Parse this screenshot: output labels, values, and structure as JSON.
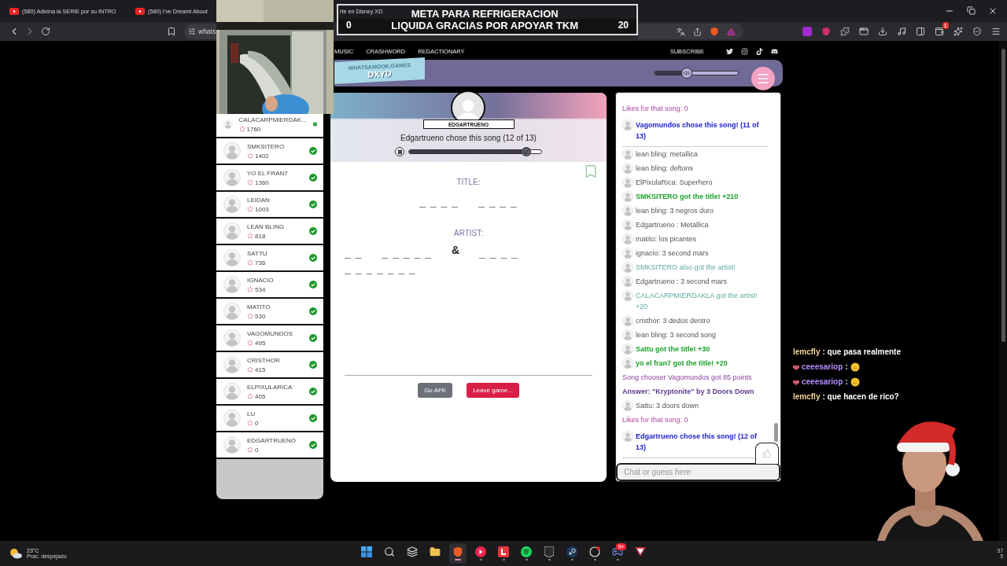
{
  "browser": {
    "tabs": [
      {
        "title": "(580) Adivina la SERIE por su INTRO",
        "selected": false
      },
      {
        "title": "(580) I've Dreamt About",
        "selected": false
      },
      {
        "title": "rte en Disney XD",
        "selected": false
      }
    ],
    "address": "whats",
    "extension_badge": "1"
  },
  "goal": {
    "current": "0",
    "lines": [
      "META PARA REFRIGERACION",
      "LIQUIDA GRACIAS POR APOYAR TKM"
    ],
    "target": "20"
  },
  "site_nav": {
    "links": [
      "MUSIC",
      "CRASHWORD",
      "REDACTIONARY"
    ],
    "subscribe": "SUBSCRIBE"
  },
  "header": {
    "logo_top": "WHATSAMOOK.GAMES",
    "logo_bottom": "DXYD",
    "volume": {
      "level": 0.39
    }
  },
  "players": [
    {
      "name": "CALACARPMIERDAK...",
      "score": "1760",
      "guessed": true
    },
    {
      "name": "SMKSITERO",
      "score": "1402",
      "guessed": true
    },
    {
      "name": "YO EL FRAN7",
      "score": "1360",
      "guessed": true
    },
    {
      "name": "LEIDAN",
      "score": "1003",
      "guessed": true
    },
    {
      "name": "LEAN BLING",
      "score": "818",
      "guessed": true
    },
    {
      "name": "SATTU",
      "score": "736",
      "guessed": true
    },
    {
      "name": "IGNACIO",
      "score": "534",
      "guessed": true
    },
    {
      "name": "MATITO",
      "score": "530",
      "guessed": true
    },
    {
      "name": "VAGOMUNDOS",
      "score": "495",
      "guessed": true
    },
    {
      "name": "CRISTHOR",
      "score": "415",
      "guessed": true
    },
    {
      "name": "ELPIXULARICA",
      "score": "405",
      "guessed": true
    },
    {
      "name": "LU",
      "score": "0",
      "guessed": true
    },
    {
      "name": "EDGARTRUENO",
      "score": "0",
      "guessed": true
    }
  ],
  "song": {
    "chooser": "EDGARTRUENO",
    "caption": "Edgartrueno chose this song (12 of 13)",
    "playing": true,
    "progress": {
      "level": 0.89
    },
    "title_label": "TITLE:",
    "title_blanks": [
      "_ _ _ _",
      "_ _ _ _"
    ],
    "artist_label": "ARTIST:",
    "artist_blanks": [
      "_ _",
      "_ _ _ _ _",
      "&",
      "_ _ _ _",
      "_ _ _ _ _ _ _"
    ]
  },
  "buttons": [
    {
      "label": "Go AFK",
      "kind": "secondary"
    },
    {
      "label": "Leave game...",
      "kind": "danger"
    }
  ],
  "chat": {
    "messages": [
      {
        "kind": "likes",
        "text": "Likes for that song: 0"
      },
      {
        "kind": "chooser",
        "text": "Vagomundos chose this song! (11 of 13)"
      },
      {
        "kind": "chat",
        "text": "lean bling: metallica"
      },
      {
        "kind": "chat",
        "text": "lean bling: deftons"
      },
      {
        "kind": "chat",
        "text": "ElPixulaRica: Superhero"
      },
      {
        "kind": "title",
        "text": "SMKSITERO got the title! +210"
      },
      {
        "kind": "chat",
        "text": "lean bling: 3 negros duro"
      },
      {
        "kind": "chat",
        "text": "Edgartrueno : Metallica"
      },
      {
        "kind": "chat",
        "text": "matito: los picantes"
      },
      {
        "kind": "chat",
        "text": "ignacio: 3 second mars"
      },
      {
        "kind": "artist",
        "text": "SMKSITERO also got the artist!"
      },
      {
        "kind": "chat",
        "text": "Edgartrueno : 3 second mars"
      },
      {
        "kind": "artist",
        "text": "CALACARPMIERDAKLA got the artist! +20"
      },
      {
        "kind": "chat",
        "text": "cristhor: 3 dedos dentro"
      },
      {
        "kind": "chat",
        "text": "lean bling: 3 second song"
      },
      {
        "kind": "title",
        "text": "Sattu got the title! +30"
      },
      {
        "kind": "title",
        "text": "yo el fran7 got the title! +20"
      },
      {
        "kind": "system",
        "text": "Song chooser Vagomundos got 85 points"
      },
      {
        "kind": "answer",
        "text": "Answer: \"Kryptonite\" by 3 Doors Down"
      },
      {
        "kind": "chat",
        "text": "Sattu: 3 doors down"
      },
      {
        "kind": "likes",
        "text": "Likes for that song: 0"
      },
      {
        "kind": "chooser",
        "text": "Edgartrueno chose this song! (12 of 13)"
      }
    ],
    "placeholder": "Chat or guess here"
  },
  "stream_chat": [
    {
      "user": "lemcfly",
      "color": "#f2d497",
      "text": ": que pasa realmente",
      "badge": false,
      "emoji": false
    },
    {
      "user": "ceeesariop",
      "color": "#b68cff",
      "text": ":",
      "badge": true,
      "emoji": true
    },
    {
      "user": "ceeesariop",
      "color": "#b68cff",
      "text": ":",
      "badge": true,
      "emoji": true
    },
    {
      "user": "lemcfly",
      "color": "#f2d497",
      "text": ": que hacen de rico?",
      "badge": false,
      "emoji": false
    }
  ],
  "weather": {
    "temp": "23°C",
    "desc": "Prac. despejado"
  },
  "taskbar": {
    "apps": [
      {
        "kind": "start",
        "running": false,
        "active": false
      },
      {
        "kind": "search",
        "running": false,
        "active": false
      },
      {
        "kind": "taskview",
        "running": false,
        "active": false
      },
      {
        "kind": "folder",
        "running": false,
        "active": false
      },
      {
        "kind": "lion",
        "running": true,
        "active": true
      },
      {
        "kind": "play",
        "running": true,
        "active": false
      },
      {
        "kind": "tile",
        "running": true,
        "active": false
      },
      {
        "kind": "waves",
        "running": true,
        "active": false
      },
      {
        "kind": "epic",
        "running": true,
        "active": false
      },
      {
        "kind": "steam",
        "running": true,
        "active": false
      },
      {
        "kind": "clock",
        "running": true,
        "active": false
      },
      {
        "kind": "controller",
        "running": true,
        "active": false,
        "badge": "9+"
      },
      {
        "kind": "triangle",
        "running": false,
        "active": false
      }
    ]
  },
  "clock": [
    "57",
    "5"
  ]
}
